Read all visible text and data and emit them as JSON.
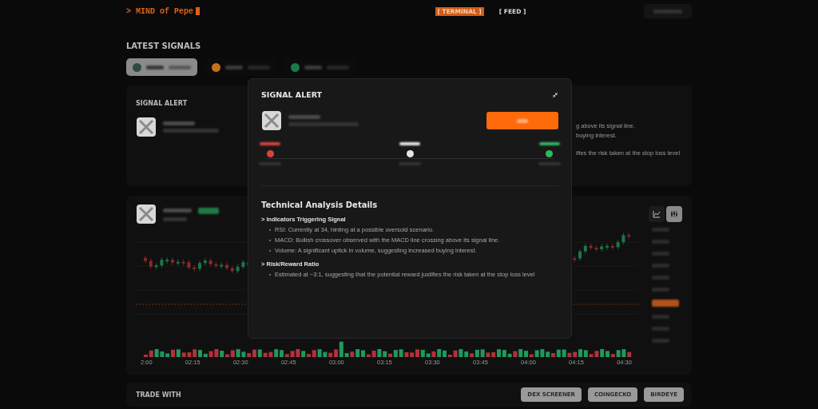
{
  "header": {
    "logo": "> MIND of Pepe",
    "tabs": [
      {
        "label": "[ TERMINAL ]",
        "selected": true
      },
      {
        "label": "[ FEED ]",
        "selected": false
      }
    ]
  },
  "latest_signals": {
    "title": "LATEST SIGNALS",
    "filters": [
      {
        "selected": true,
        "color": "#2e4a46"
      },
      {
        "selected": false,
        "color": "#c7701a"
      },
      {
        "selected": false,
        "color": "#1a7a48"
      }
    ]
  },
  "signal_card": {
    "title": "SIGNAL ALERT",
    "detail_fragments": [
      "g above its signal line.",
      "buying interest.",
      "ifies the risk taken at the stop loss level"
    ]
  },
  "chart_card": {
    "view_toggle": [
      {
        "kind": "line",
        "selected": false
      },
      {
        "kind": "candles",
        "selected": true
      }
    ],
    "time_labels": [
      "2:00",
      "02:15",
      "02:30",
      "02:45",
      "03:00",
      "03:15",
      "03:30",
      "03:45",
      "04:00",
      "04:15",
      "04:30"
    ]
  },
  "trade": {
    "title": "TRADE WITH",
    "buttons": [
      "DEX SCREENER",
      "COINGECKO",
      "BIRDEYE"
    ]
  },
  "modal": {
    "title": "SIGNAL ALERT",
    "levels": [
      {
        "color": "#d9433f"
      },
      {
        "color": "#e6e6e6"
      },
      {
        "color": "#2fb95c"
      }
    ],
    "heading": "Technical Analysis Details",
    "sections": [
      {
        "title": "> Indicators Triggering Signal",
        "items": [
          "RSI: Currently at 34, hinting at a possible oversold scenario.",
          "MACD: Bullish crossover observed with the MACD line crossing above its signal line.",
          "Volume: A significant uptick in volume, suggesting increased buying interest."
        ]
      },
      {
        "title": "> Risk/Reward Ratio",
        "items": [
          "Estimated at ~3:1, suggesting that the potential reward justifies the risk taken at the stop loss level"
        ]
      }
    ]
  }
}
